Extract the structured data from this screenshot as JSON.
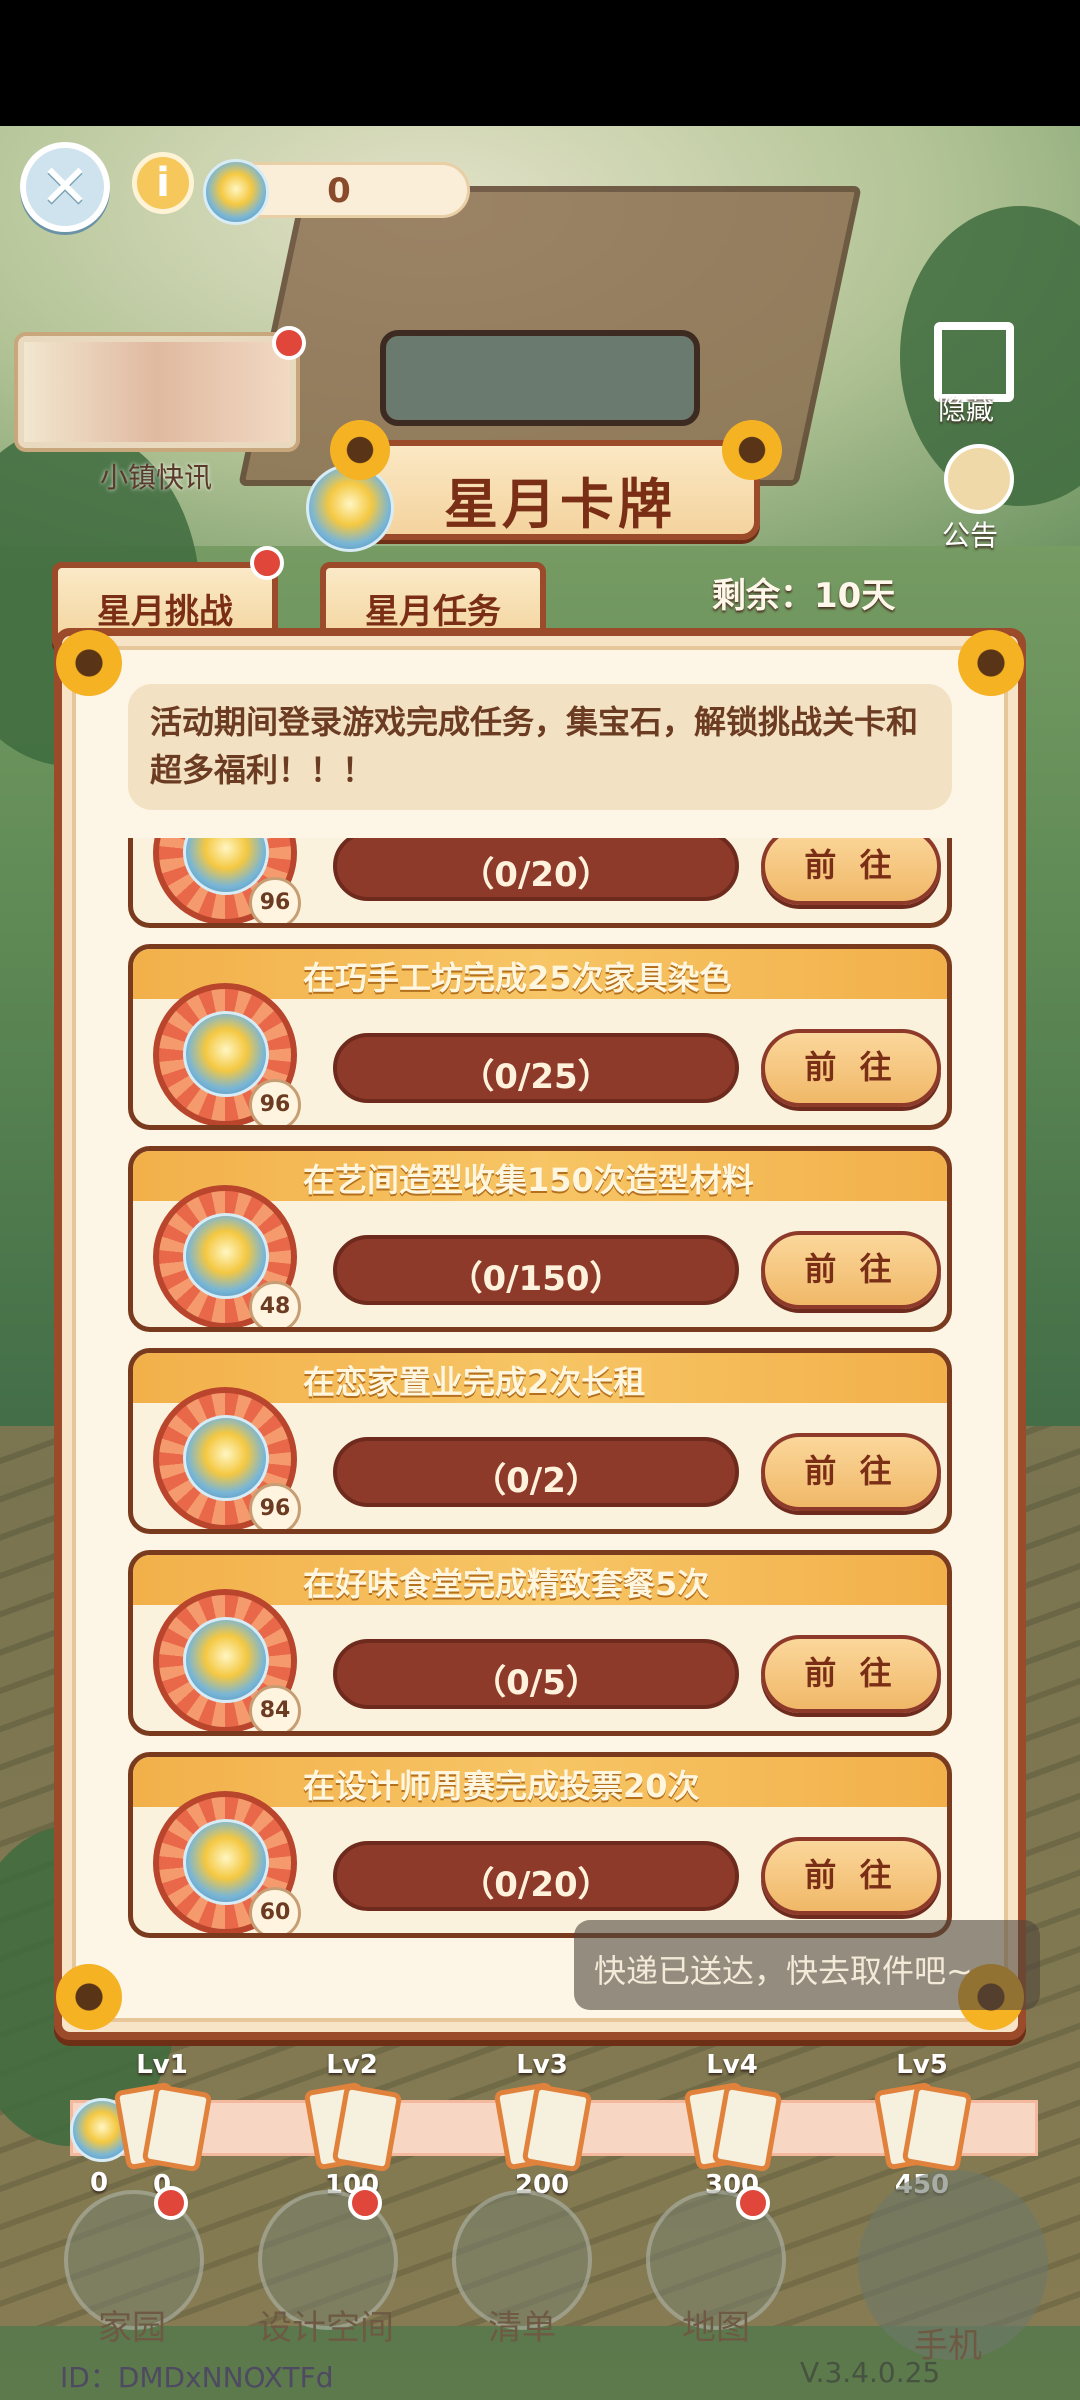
{
  "header": {
    "gem_count": "0"
  },
  "sidebar": {
    "news_label": "小镇快讯",
    "hide_label": "隐藏",
    "notice_label": "公告"
  },
  "event": {
    "title": "星月卡牌",
    "tabs": [
      {
        "label": "星月挑战"
      },
      {
        "label": "星月任务"
      }
    ],
    "remaining": "剩余：10天",
    "description": "活动期间登录游戏完成任务，集宝石，解锁挑战关卡和超多福利！！！"
  },
  "tasks": [
    {
      "title": "",
      "progress_text": "（0/20）",
      "progress": 0,
      "reward": "96",
      "button": "前 往"
    },
    {
      "title": "在巧手工坊完成25次家具染色",
      "progress_text": "（0/25）",
      "progress": 0,
      "reward": "96",
      "button": "前 往"
    },
    {
      "title": "在艺间造型收集150次造型材料",
      "progress_text": "（0/150）",
      "progress": 0,
      "reward": "48",
      "button": "前 往"
    },
    {
      "title": "在恋家置业完成2次长租",
      "progress_text": "（0/2）",
      "progress": 0,
      "reward": "96",
      "button": "前 往"
    },
    {
      "title": "在好味食堂完成精致套餐5次",
      "progress_text": "（0/5）",
      "progress": 0,
      "reward": "84",
      "button": "前 往"
    },
    {
      "title": "在设计师周赛完成投票20次",
      "progress_text": "（0/20）",
      "progress": 0,
      "reward": "60",
      "button": "前 往"
    }
  ],
  "milestones": {
    "start": "0",
    "levels": [
      {
        "lv": "Lv1",
        "value": "0"
      },
      {
        "lv": "Lv2",
        "value": "100"
      },
      {
        "lv": "Lv3",
        "value": "200"
      },
      {
        "lv": "Lv4",
        "value": "300"
      },
      {
        "lv": "Lv5",
        "value": "450"
      }
    ]
  },
  "toast": "快递已送达，快去取件吧~",
  "nav": {
    "home": "家园",
    "design": "设计空间",
    "list": "清单",
    "map": "地图",
    "phone": "手机"
  },
  "footer": {
    "id": "ID：DMDxNNOXTFd",
    "version": "V.3.4.0.25"
  },
  "colors": {
    "accent": "#9b4a2a",
    "panel": "#fdf6e6",
    "progress_bar": "#8e3a2a",
    "button": "#f0b868",
    "badge": "#e9684a"
  }
}
